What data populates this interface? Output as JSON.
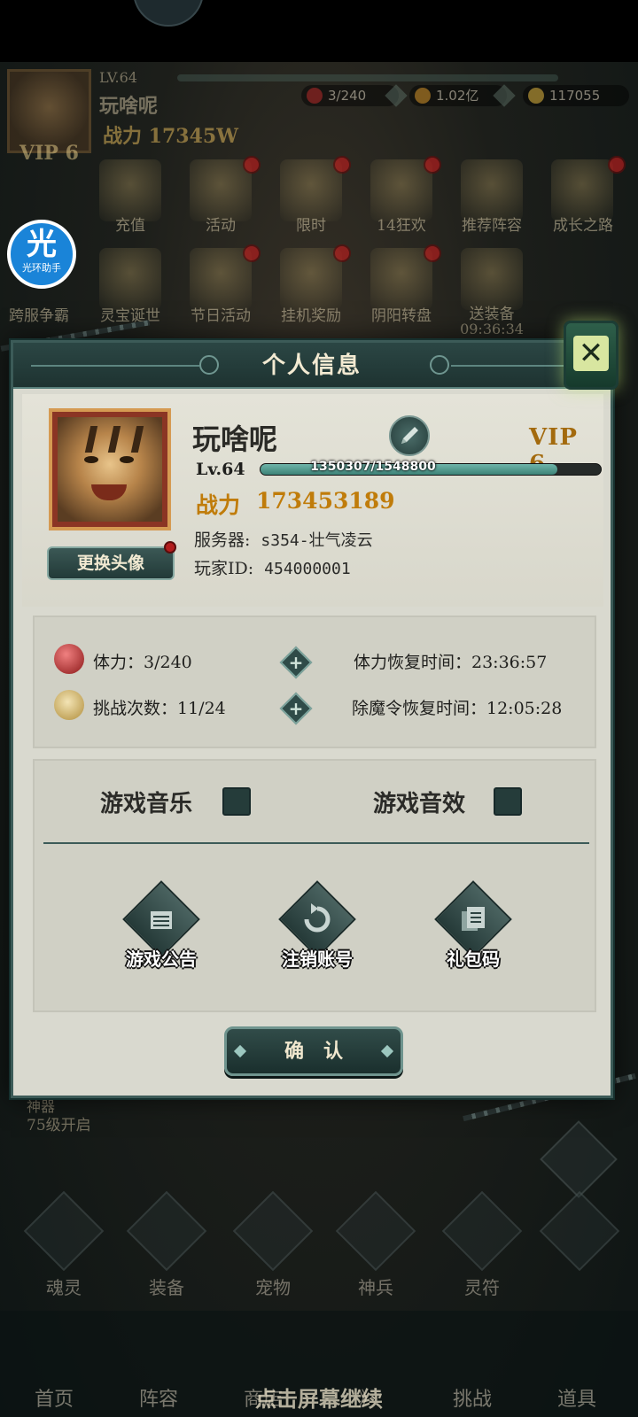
{
  "hud": {
    "level": "LV.64",
    "name": "玩啥呢",
    "power": "战力 17345W",
    "vip": "VIP 6",
    "stamina": "3/240",
    "gold": "1.02亿",
    "gems": "117055"
  },
  "activity_menu": {
    "row1": [
      "充值",
      "活动",
      "限时",
      "14狂欢",
      "推荐阵容",
      "成长之路"
    ],
    "row2": [
      "跨服争霸",
      "灵宝诞世",
      "节日活动",
      "挂机奖励",
      "阴阳转盘",
      "送装备"
    ],
    "timer": "09:36:34"
  },
  "assistant": {
    "glyph": "光",
    "caption": "光环助手"
  },
  "background": {
    "artifact_lock": {
      "name": "神器",
      "hint": "75级开启"
    },
    "function_bar": [
      "魂灵",
      "装备",
      "宠物",
      "神兵",
      "灵符"
    ],
    "nav": [
      "首页",
      "阵容",
      "商店",
      "》",
      "挑战",
      "道具"
    ],
    "tap_hint": "点击屏幕继续"
  },
  "dialog": {
    "title": "个人信息",
    "close_icon": "✕",
    "profile": {
      "name": "玩啥呢",
      "vip": "VIP 6",
      "level": "Lv.64",
      "exp_text": "1350307/1548800",
      "exp_fraction": 0.8718,
      "power_label": "战力",
      "power_value": "173453189",
      "server_label": "服务器:",
      "server_value": "s354-壮气凌云",
      "player_id_label": "玩家ID:",
      "player_id_value": "454000001",
      "change_avatar": "更换头像"
    },
    "stats": {
      "stamina": "体力：3/240",
      "stamina_recover": "体力恢复时间：23:36:57",
      "challenges": "挑战次数：11/24",
      "token_recover": "除魔令恢复时间：12:05:28"
    },
    "settings": {
      "music": "游戏音乐",
      "sfx": "游戏音效",
      "announcement": "游戏公告",
      "logout": "注销账号",
      "gift_code": "礼包码"
    },
    "confirm": "确认"
  },
  "colors": {
    "panel": "#d9d9cf",
    "header": "#2b4644",
    "accent_gold": "#c07c0a",
    "exp_fill": "#4f9a8e"
  }
}
